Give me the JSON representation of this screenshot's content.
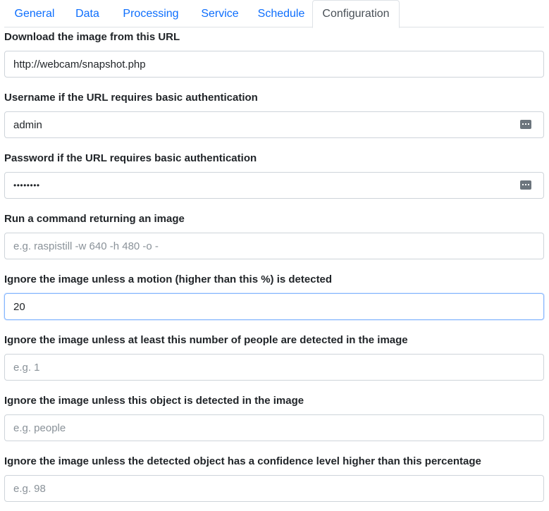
{
  "tabs": [
    {
      "label": "General",
      "active": false
    },
    {
      "label": "Data",
      "active": false
    },
    {
      "label": "Processing",
      "active": false
    },
    {
      "label": "Service",
      "active": false
    },
    {
      "label": "Schedule",
      "active": false
    },
    {
      "label": "Configuration",
      "active": true
    }
  ],
  "fields": {
    "url": {
      "label": "Download the image from this URL",
      "value": "http://webcam/snapshot.php",
      "placeholder": ""
    },
    "username": {
      "label": "Username if the URL requires basic authentication",
      "value": "admin",
      "placeholder": "",
      "icon": "password-manager-icon"
    },
    "password": {
      "label": "Password if the URL requires basic authentication",
      "value": "••••••••",
      "placeholder": "",
      "icon": "password-manager-icon"
    },
    "command": {
      "label": "Run a command returning an image",
      "value": "",
      "placeholder": "e.g. raspistill -w 640 -h 480 -o -"
    },
    "motion": {
      "label": "Ignore the image unless a motion (higher than this %) is detected",
      "value": "20",
      "placeholder": ""
    },
    "people": {
      "label": "Ignore the image unless at least this number of people are detected in the image",
      "value": "",
      "placeholder": "e.g. 1"
    },
    "object": {
      "label": "Ignore the image unless this object is detected in the image",
      "value": "",
      "placeholder": "e.g. people"
    },
    "confidence": {
      "label": "Ignore the image unless the detected object has a confidence level higher than this percentage",
      "value": "",
      "placeholder": "e.g. 98"
    }
  },
  "colors": {
    "link": "#0d6efd",
    "active_tab": "#495057",
    "focus_border": "#86b7fe"
  }
}
